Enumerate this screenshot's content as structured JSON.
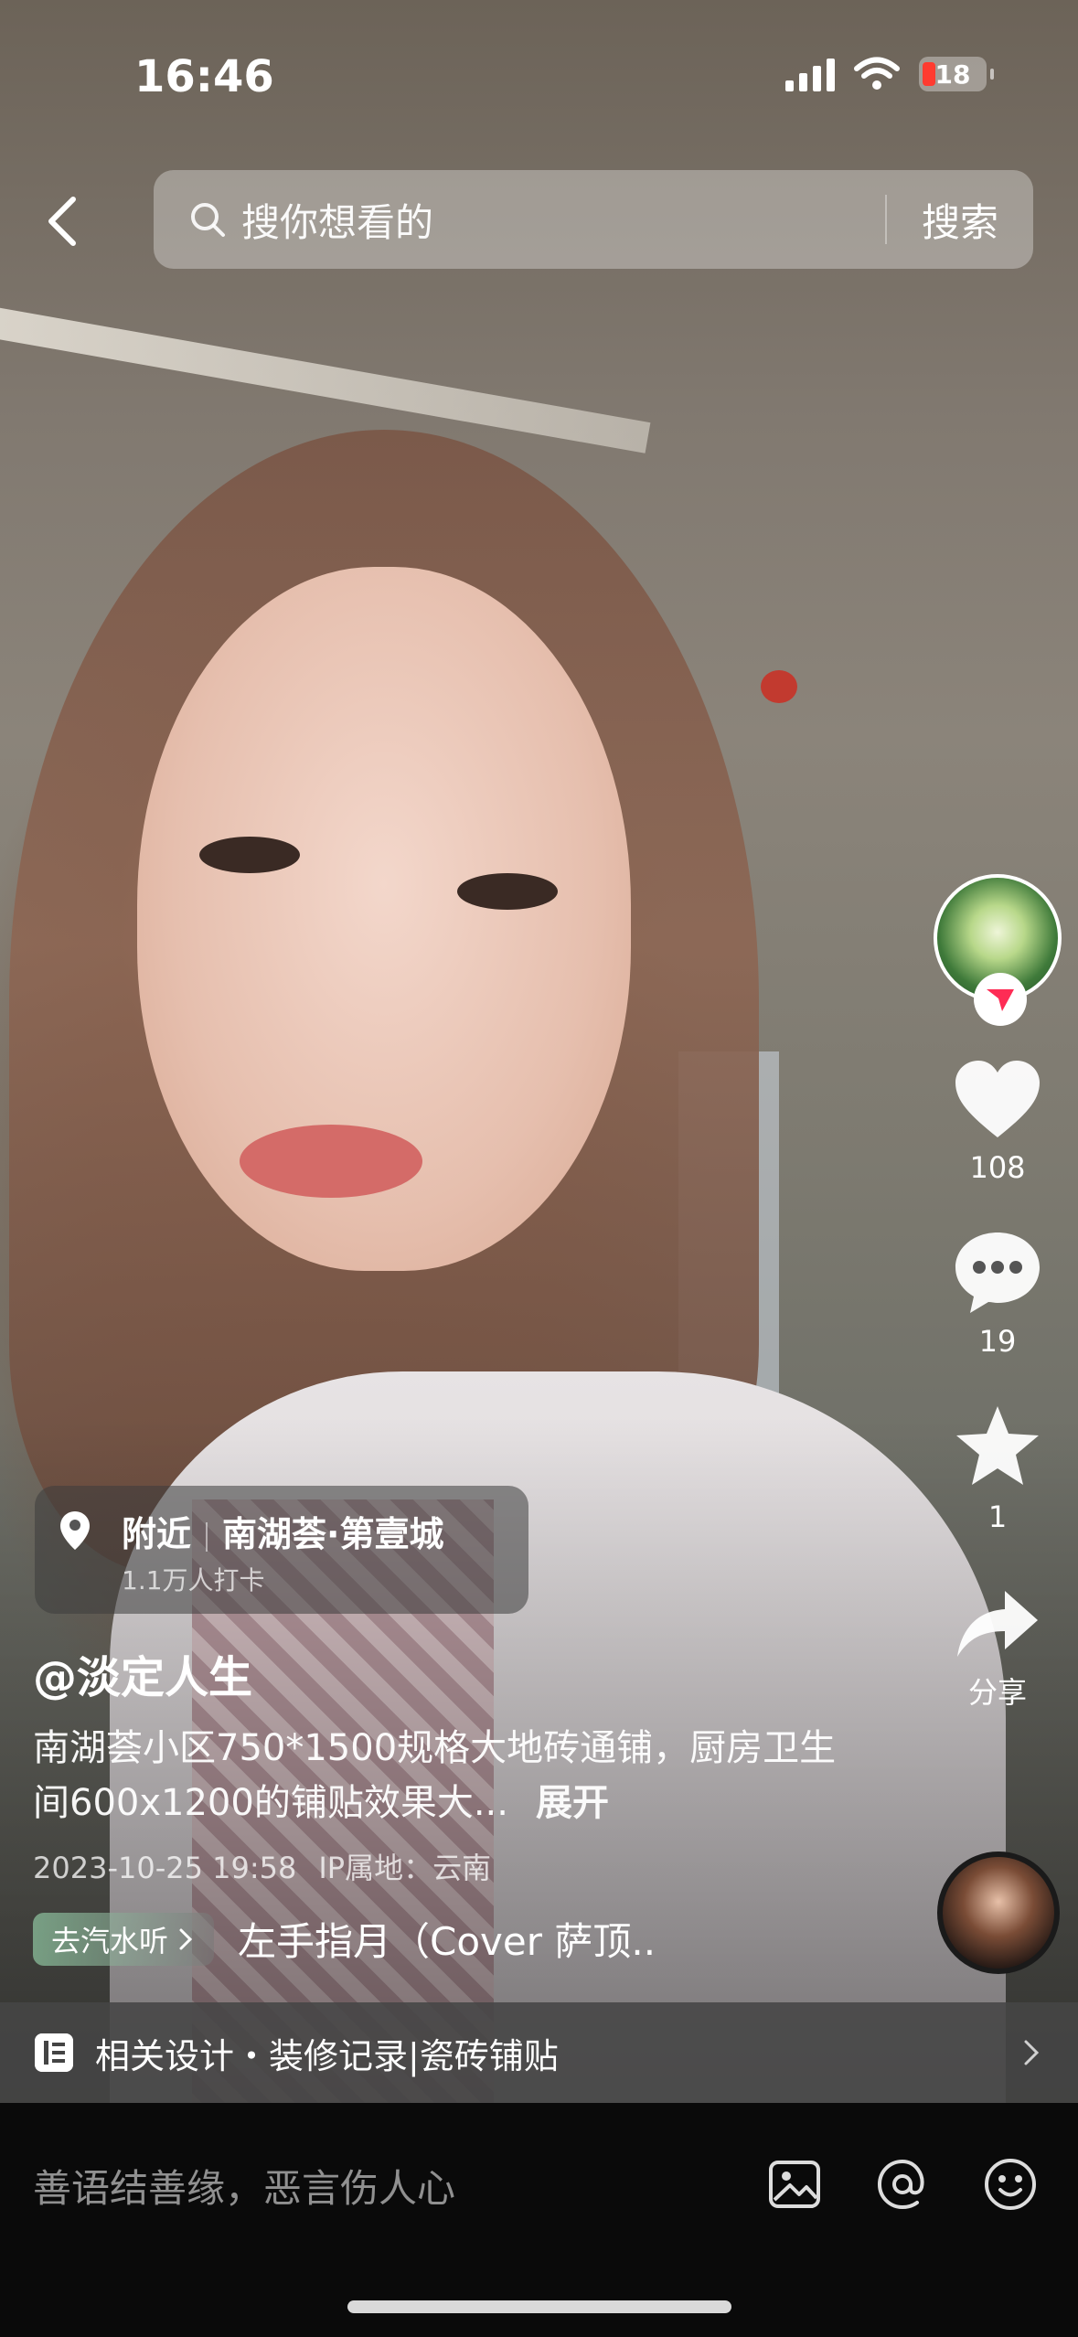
{
  "status_bar": {
    "time": "16:46",
    "battery": "18",
    "icons": [
      "signal-icon",
      "wifi-icon",
      "battery-icon"
    ]
  },
  "search": {
    "placeholder": "搜你想看的",
    "button": "搜索",
    "back_icon": "chevron-left-icon"
  },
  "side_actions": {
    "likes": "108",
    "comments": "19",
    "favorites": "1",
    "share_label": "分享"
  },
  "location": {
    "prefix": "附近",
    "place": "南湖荟·第壹城",
    "checkins": "1.1万人打卡"
  },
  "post": {
    "author": "@淡定人生",
    "description": "南湖荟小区750*1500规格大地砖通铺，厨房卫生间600x1200的铺贴效果大...",
    "expand": "展开",
    "date": "2023-10-25 19:58",
    "ip": "IP属地：云南"
  },
  "music": {
    "qishui_label": "去汽水听",
    "title": "左手指月（Cover 萨顶.."
  },
  "related": {
    "text": "相关设计・装修记录|瓷砖铺贴"
  },
  "comment_bar": {
    "placeholder": "善语结善缘，恶言伤人心"
  },
  "colors": {
    "accent_red": "#fe2c55",
    "battery_low": "#ff3b30"
  }
}
